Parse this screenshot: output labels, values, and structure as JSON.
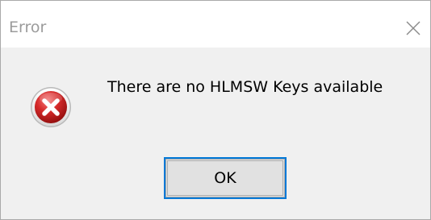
{
  "window": {
    "title": "Error",
    "close_symbol": "×"
  },
  "dialog": {
    "icon": "error-icon",
    "message": "There are no HLMSW Keys available",
    "ok_label": "OK"
  },
  "colors": {
    "title_text": "#9b9b9b",
    "content_bg": "#f0f0f0",
    "button_bg": "#e1e1e1",
    "focus_border": "#0078d7",
    "icon_red": "#c41a1a"
  }
}
